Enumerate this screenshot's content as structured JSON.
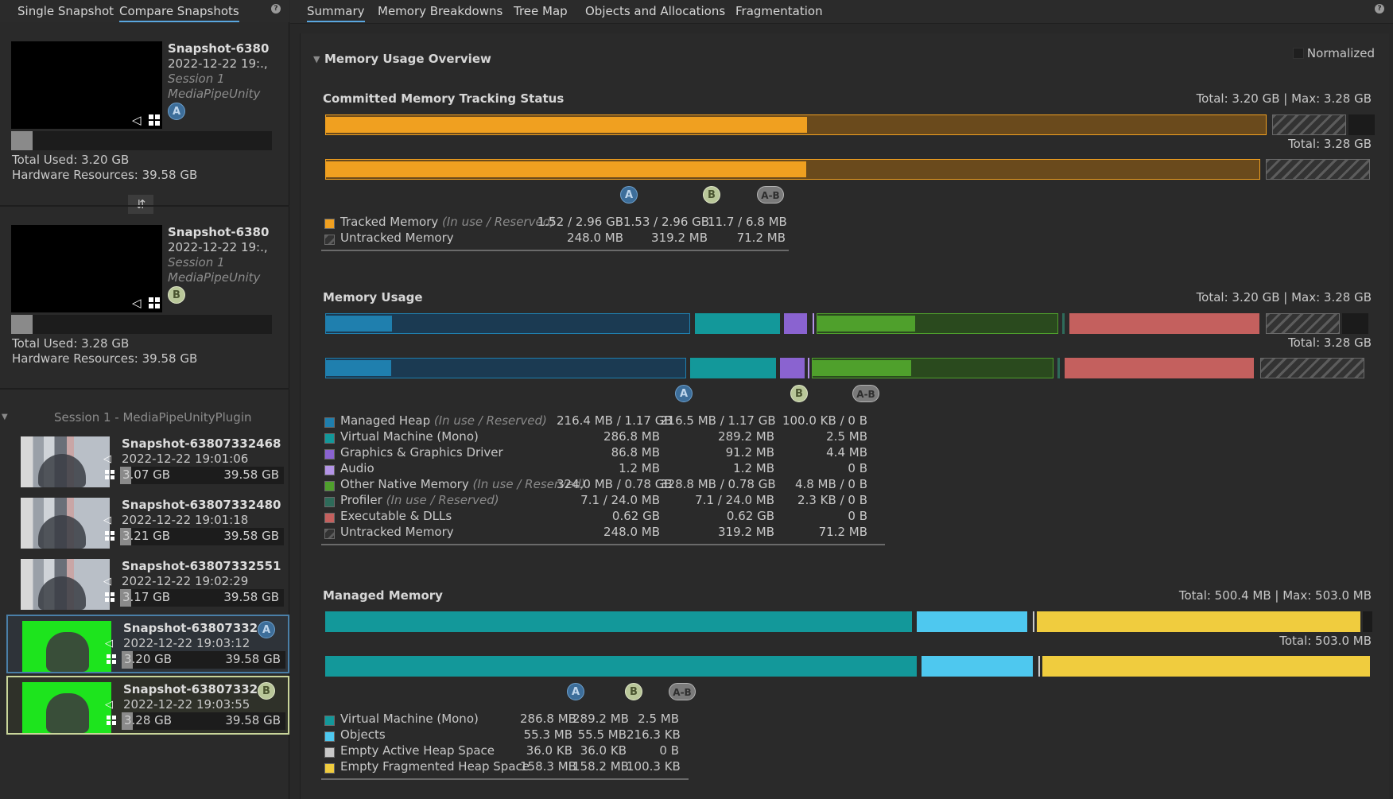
{
  "left_tabs": {
    "single": "Single Snapshot",
    "compare": "Compare Snapshots",
    "help": "?"
  },
  "snapshot_a": {
    "title": "Snapshot-6380",
    "date": "2022-12-22 19:.,",
    "session": "Session 1",
    "project": "MediaPipeUnity",
    "badge": "A",
    "total_used": "Total Used: 3.20 GB",
    "hardware": "Hardware Resources: 39.58 GB",
    "used_fraction": 0.081
  },
  "snapshot_b": {
    "title": "Snapshot-6380",
    "date": "2022-12-22 19:.,",
    "session": "Session 1",
    "project": "MediaPipeUnity",
    "badge": "B",
    "total_used": "Total Used: 3.28 GB",
    "hardware": "Hardware Resources: 39.58 GB",
    "used_fraction": 0.083
  },
  "swap_icon": "⇵",
  "session_label": "Session 1 - MediaPipeUnityPlugin",
  "session_list": [
    {
      "title": "Snapshot-63807332468",
      "date": "2022-12-22 19:01:06",
      "used": "3.07 GB",
      "hw": "39.58 GB",
      "thumb": "office"
    },
    {
      "title": "Snapshot-63807332480",
      "date": "2022-12-22 19:01:18",
      "used": "3.21 GB",
      "hw": "39.58 GB",
      "thumb": "office"
    },
    {
      "title": "Snapshot-63807332551",
      "date": "2022-12-22 19:02:29",
      "used": "3.17 GB",
      "hw": "39.58 GB",
      "thumb": "office"
    },
    {
      "title": "Snapshot-63807332",
      "date": "2022-12-22 19:03:12",
      "used": "3.20 GB",
      "hw": "39.58 GB",
      "thumb": "green",
      "badge": "A"
    },
    {
      "title": "Snapshot-63807332",
      "date": "2022-12-22 19:03:55",
      "used": "3.28 GB",
      "hw": "39.58 GB",
      "thumb": "green",
      "badge": "B"
    }
  ],
  "right_tabs": [
    "Summary",
    "Memory Breakdowns",
    "Tree Map",
    "Objects and Allocations",
    "Fragmentation"
  ],
  "help": "?",
  "overview": {
    "title": "Memory Usage Overview",
    "normalized": "Normalized"
  },
  "badges": {
    "a": "A",
    "b": "B",
    "ab": "A-B"
  },
  "committed": {
    "title": "Committed Memory Tracking Status",
    "total_max": "Total: 3.20 GB | Max: 3.28 GB",
    "total_b": "Total: 3.28 GB",
    "rows": [
      {
        "name": "Tracked Memory",
        "note": "(In use / Reserved)",
        "a": "1.52 / 2.96 GB",
        "b": "1.53 / 2.96 GB",
        "diff": "11.7 / 6.8 MB",
        "color": "#f0a020"
      },
      {
        "name": "Untracked Memory",
        "note": "",
        "a": "248.0 MB",
        "b": "319.2 MB",
        "diff": "71.2 MB",
        "color": "hatch"
      }
    ]
  },
  "usage": {
    "title": "Memory Usage",
    "total_max": "Total: 3.20 GB | Max: 3.28 GB",
    "total_b": "Total: 3.28 GB",
    "rows": [
      {
        "name": "Managed Heap",
        "note": "(In use / Reserved)",
        "a": "216.4 MB / 1.17 GB",
        "b": "216.5 MB / 1.17 GB",
        "diff": "100.0 KB / 0 B",
        "color": "#1f7fae"
      },
      {
        "name": "Virtual Machine (Mono)",
        "note": "",
        "a": "286.8 MB",
        "b": "289.2 MB",
        "diff": "2.5 MB",
        "color": "#13989a"
      },
      {
        "name": "Graphics & Graphics Driver",
        "note": "",
        "a": "86.8 MB",
        "b": "91.2 MB",
        "diff": "4.4 MB",
        "color": "#8a63d0"
      },
      {
        "name": "Audio",
        "note": "",
        "a": "1.2 MB",
        "b": "1.2 MB",
        "diff": "0 B",
        "color": "#b394e6"
      },
      {
        "name": "Other Native Memory",
        "note": "(In use / Reserved)",
        "a": "324.0 MB / 0.78 GB",
        "b": "328.8 MB / 0.78 GB",
        "diff": "4.8 MB / 0 B",
        "color": "#4fa02c"
      },
      {
        "name": "Profiler",
        "note": "(In use / Reserved)",
        "a": "7.1 / 24.0 MB",
        "b": "7.1 / 24.0 MB",
        "diff": "2.3 KB / 0 B",
        "color": "#2e6b5a"
      },
      {
        "name": "Executable & DLLs",
        "note": "",
        "a": "0.62 GB",
        "b": "0.62 GB",
        "diff": "0 B",
        "color": "#c4605e"
      },
      {
        "name": "Untracked Memory",
        "note": "",
        "a": "248.0 MB",
        "b": "319.2 MB",
        "diff": "71.2 MB",
        "color": "hatch"
      }
    ]
  },
  "managed": {
    "title": "Managed Memory",
    "total_max": "Total: 500.4 MB | Max: 503.0 MB",
    "total_b": "Total: 503.0 MB",
    "rows": [
      {
        "name": "Virtual Machine (Mono)",
        "a": "286.8 MB",
        "b": "289.2 MB",
        "diff": "2.5 MB",
        "color": "#13989a"
      },
      {
        "name": "Objects",
        "a": "55.3 MB",
        "b": "55.5 MB",
        "diff": "216.3 KB",
        "color": "#4ec8ef"
      },
      {
        "name": "Empty Active Heap Space",
        "a": "36.0 KB",
        "b": "36.0 KB",
        "diff": "0 B",
        "color": "#c8c8c8"
      },
      {
        "name": "Empty Fragmented Heap Space",
        "a": "158.3 MB",
        "b": "158.2 MB",
        "diff": "100.3 KB",
        "color": "#f0cc3e"
      }
    ]
  }
}
